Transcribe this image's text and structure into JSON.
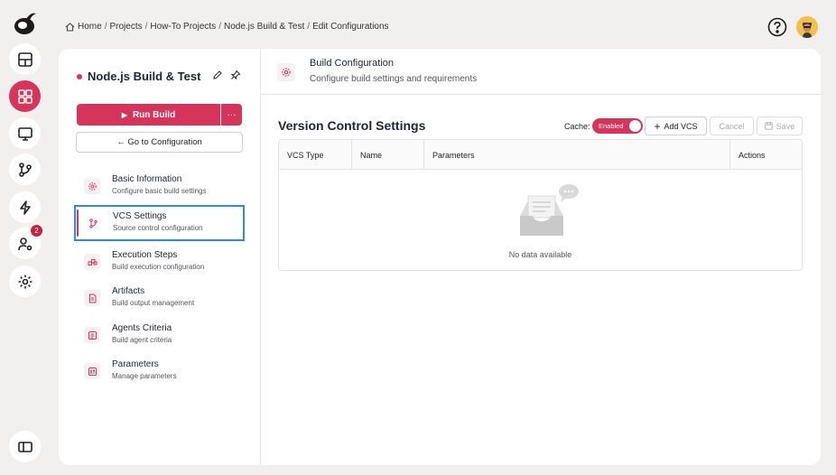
{
  "breadcrumb": {
    "items": [
      "Home",
      "Projects",
      "How-To Projects",
      "Node.js Build & Test",
      "Edit Configurations"
    ],
    "separator": "/"
  },
  "rail": {
    "items": [
      "dashboard-icon",
      "projects-icon",
      "monitor-icon",
      "git-branch-icon",
      "lightning-icon",
      "user-settings-icon",
      "settings-icon"
    ],
    "active": "projects-icon",
    "badge_count": "2"
  },
  "project": {
    "title": "Node.js Build & Test",
    "run_label": "Run Build",
    "more_label": "···",
    "goto_label": "← Go to Configuration"
  },
  "nav": {
    "items": [
      {
        "title": "Basic Information",
        "subtitle": "Configure basic build settings"
      },
      {
        "title": "VCS Settings",
        "subtitle": "Source control configuration"
      },
      {
        "title": "Execution Steps",
        "subtitle": "Build execution configuration"
      },
      {
        "title": "Artifacts",
        "subtitle": "Build output management"
      },
      {
        "title": "Agents Criteria",
        "subtitle": "Build agent criteria"
      },
      {
        "title": "Parameters",
        "subtitle": "Manage parameters"
      }
    ],
    "selected": "VCS Settings"
  },
  "header": {
    "title": "Build Configuration",
    "subtitle": "Configure build settings and requirements"
  },
  "vcs": {
    "title": "Version Control Settings",
    "cache_label": "Cache:",
    "cache_state": "Enabled",
    "add_label": "Add VCS",
    "cancel_label": "Cancel",
    "save_label": "Save",
    "columns": [
      "VCS Type",
      "Name",
      "Parameters",
      "Actions"
    ],
    "rows": [],
    "empty_text": "No data available"
  },
  "colors": {
    "accent": "#d6345a",
    "selection_outline": "#2f8ae0",
    "badge": "#c8203f"
  }
}
